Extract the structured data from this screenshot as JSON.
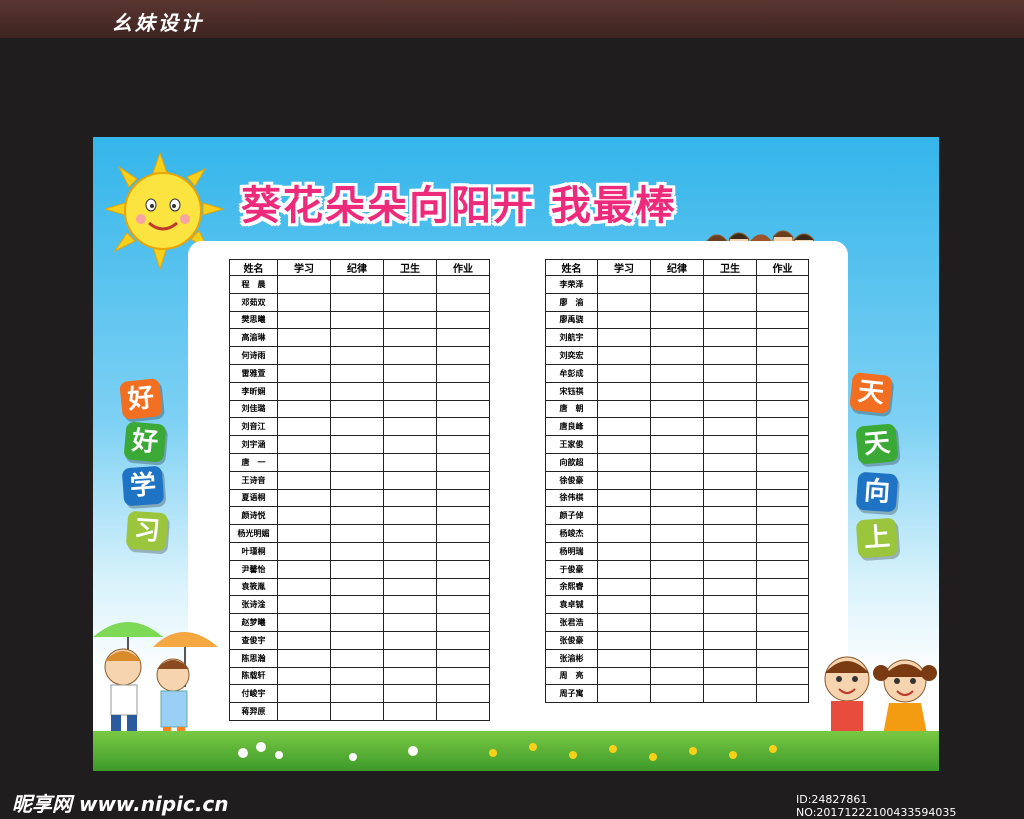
{
  "header": {
    "brand": "幺妹设计"
  },
  "poster": {
    "title": "葵花朵朵向阳开  我最棒",
    "left_slogan": [
      "好",
      "好",
      "学",
      "习"
    ],
    "right_slogan": [
      "天",
      "天",
      "向",
      "上"
    ],
    "colors": {
      "title": "#ee2a7b",
      "sky": "#34b5ea",
      "grass": "#5cb838"
    }
  },
  "table": {
    "headers": [
      "姓名",
      "学习",
      "纪律",
      "卫生",
      "作业"
    ],
    "left_names": [
      "程　晨",
      "邓茹双",
      "樊思曦",
      "高渝琳",
      "何诗雨",
      "雷雅萱",
      "李昕娴",
      "刘佳璐",
      "刘音江",
      "刘宇涵",
      "唐　一",
      "王诗音",
      "夏语桐",
      "颜诗悦",
      "杨光明媚",
      "叶瑾桐",
      "尹馨怡",
      "袁筱胤",
      "张诗淦",
      "赵梦曦",
      "查俊宇",
      "陈思瀚",
      "陈载轩",
      "付峻宇",
      "蒋羿原"
    ],
    "right_names": [
      "李荣泽",
      "廖　渝",
      "廖禹骁",
      "刘航宇",
      "刘奕宏",
      "牟彭成",
      "宋钰祺",
      "唐　朝",
      "唐良峰",
      "王家俊",
      "向歆超",
      "徐俊豪",
      "徐伟棋",
      "颜子倬",
      "杨竣杰",
      "杨明瑞",
      "于俊豪",
      "余熙睿",
      "袁卓铖",
      "张君浩",
      "张俊豪",
      "张渝彬",
      "周　亮",
      "周子寓"
    ]
  },
  "footer": {
    "watermark_left": "昵享网 www.nipic.cn",
    "watermark_right": "ID:24827861 NO:20171222100433594035"
  }
}
